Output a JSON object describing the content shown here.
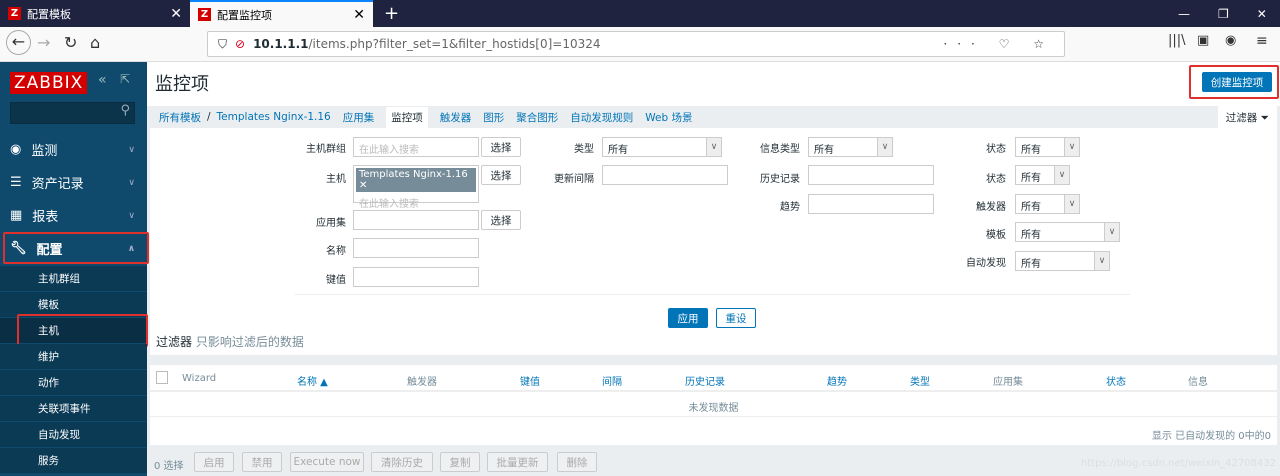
{
  "browser": {
    "tabs": [
      {
        "label": "配置模板"
      },
      {
        "label": "配置监控项"
      }
    ],
    "url_host": "10.1.1.1",
    "url_path": "/items.php?filter_set=1&filter_hostids[0]=10324"
  },
  "sidebar": {
    "logo": "ZABBIX",
    "menu": [
      {
        "label": "监测",
        "icon": "eye-icon"
      },
      {
        "label": "资产记录",
        "icon": "list-icon"
      },
      {
        "label": "报表",
        "icon": "chart-icon"
      },
      {
        "label": "配置",
        "icon": "wrench-icon"
      }
    ],
    "submenu": [
      "主机群组",
      "模板",
      "主机",
      "维护",
      "动作",
      "关联项事件",
      "自动发现",
      "服务"
    ]
  },
  "page": {
    "title": "监控项",
    "create_button": "创建监控项",
    "filter_tab": "过滤器"
  },
  "breadcrumbs": [
    "所有模板",
    "/",
    "Templates Nginx-1.16",
    "应用集",
    "监控项",
    "触发器",
    "图形",
    "聚合图形",
    "自动发现规则",
    "Web 场景"
  ],
  "filter": {
    "host_group_label": "主机群组",
    "search_placeholder": "在此输入搜索",
    "select": "选择",
    "host_label": "主机",
    "host_tag": "Templates Nginx-1.16",
    "app_label": "应用集",
    "name_label": "名称",
    "key_label": "键值",
    "type_label": "类型",
    "type_value": "所有",
    "interval_label": "更新间隔",
    "info_type_label": "信息类型",
    "info_type_value": "所有",
    "history_label": "历史记录",
    "trends_label": "趋势",
    "state_label": "状态",
    "state_value": "所有",
    "status_label": "状态",
    "status_value": "所有",
    "triggers_label": "触发器",
    "triggers_value": "所有",
    "template_label": "模板",
    "template_value": "所有",
    "discovery_label": "自动发现",
    "discovery_value": "所有",
    "apply": "应用",
    "reset": "重设",
    "note_title": "过滤器",
    "note_text": "只影响过滤后的数据"
  },
  "table": {
    "headers": [
      "Wizard",
      "名称 ▲",
      "触发器",
      "键值",
      "间隔",
      "历史记录",
      "趋势",
      "类型",
      "应用集",
      "状态",
      "信息"
    ],
    "empty": "未发现数据",
    "footer": "显示 已自动发现的 0中的0"
  },
  "actions": {
    "selected": "0 选择",
    "buttons": [
      "启用",
      "禁用",
      "Execute now",
      "清除历史",
      "复制",
      "批量更新",
      "删除"
    ]
  },
  "watermark": "https://blog.csdn.net/weixin_42708432"
}
